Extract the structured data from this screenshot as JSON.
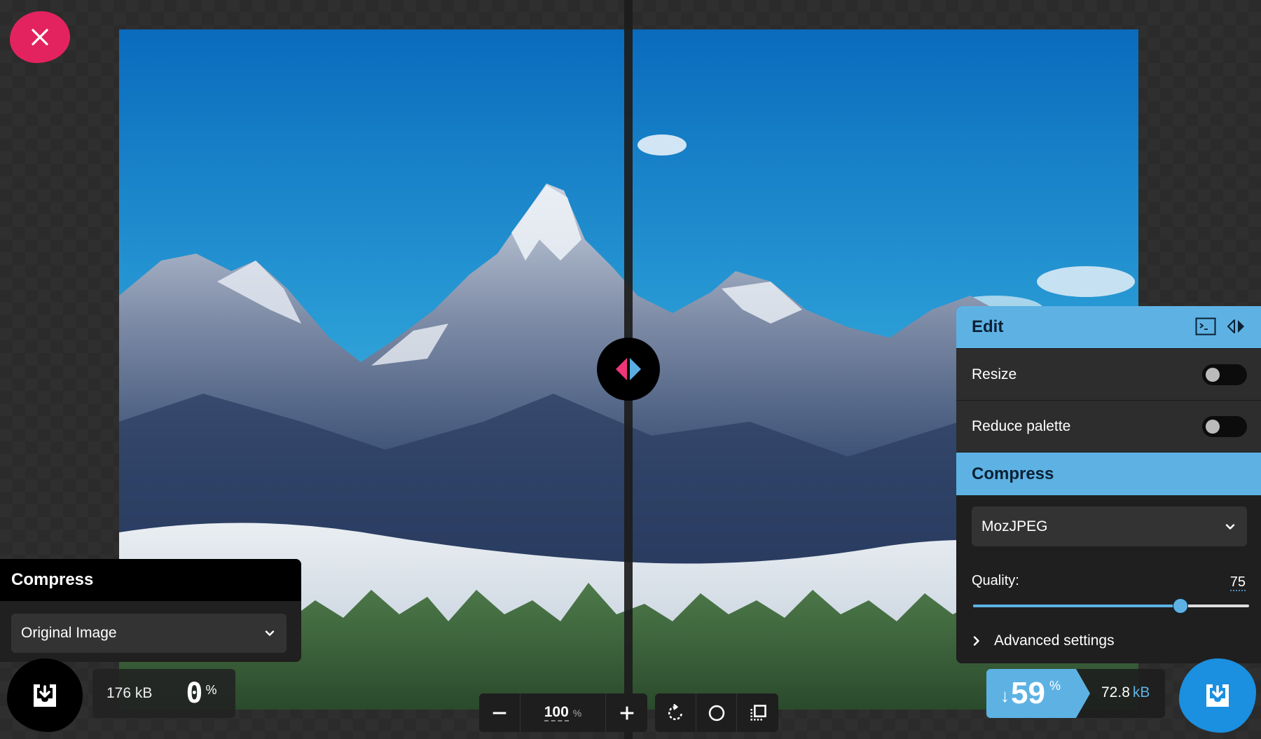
{
  "close_button": {
    "icon": "close-icon",
    "color": "#e3235f"
  },
  "image": {
    "description": "Snow-capped mountain range above a sea of clouds with pine forest in foreground"
  },
  "divider": {
    "left_color": "#f0357a",
    "right_color": "#5aaee3"
  },
  "left_panel": {
    "title": "Compress",
    "method_select": {
      "value": "Original Image"
    },
    "file_size": "176 kB",
    "savings_value": "0",
    "savings_unit": "%",
    "download_icon": "download-icon"
  },
  "zoom_controls": {
    "zoom_out_icon": "minus-icon",
    "zoom_value": "100",
    "zoom_unit": "%",
    "zoom_in_icon": "plus-icon",
    "rotate_icon": "rotate-icon",
    "background_toggle_icon": "circle-icon",
    "pixel_toggle_icon": "crop-icon"
  },
  "edit_panel": {
    "title": "Edit",
    "header_icons": [
      "terminal-icon",
      "swap-sides-icon"
    ],
    "options": [
      {
        "label": "Resize",
        "enabled": false
      },
      {
        "label": "Reduce palette",
        "enabled": false
      }
    ],
    "compress_title": "Compress",
    "method_select": {
      "value": "MozJPEG"
    },
    "quality_label": "Quality:",
    "quality_value": "75",
    "quality_range": [
      0,
      100
    ],
    "advanced_label": "Advanced settings",
    "accent_color": "#5db2e3"
  },
  "right_stats": {
    "arrow": "↓",
    "savings_value": "59",
    "savings_unit": "%",
    "file_size_value": "72.8",
    "file_size_unit": "kB",
    "download_icon": "download-icon"
  }
}
